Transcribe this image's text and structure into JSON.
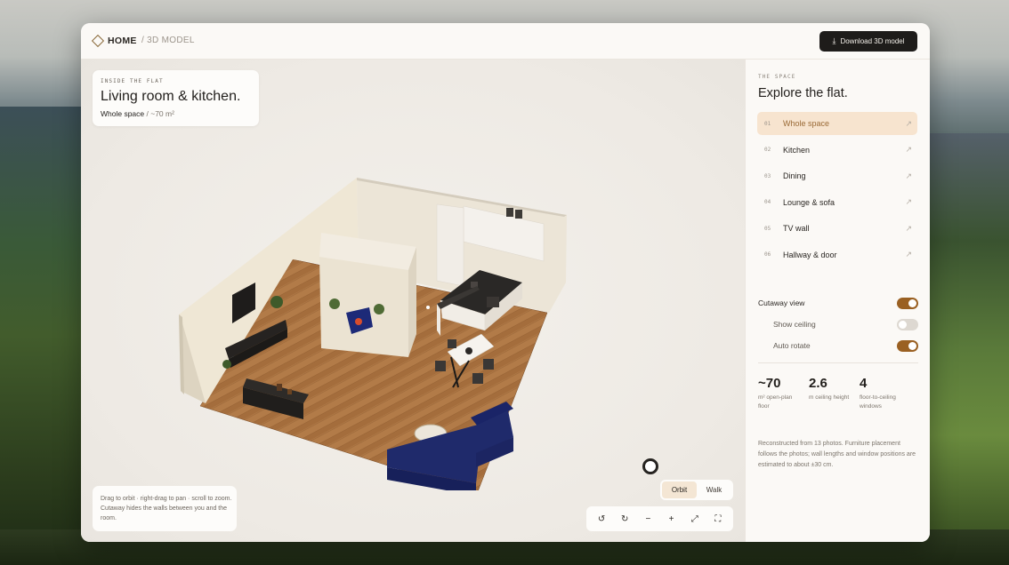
{
  "header": {
    "home_label": "HOME",
    "crumb_current": "/ 3D MODEL",
    "download_label": "Download 3D model"
  },
  "viewport": {
    "info": {
      "eyebrow": "INSIDE THE FLAT",
      "title": "Living room & kitchen.",
      "subtitle_primary": "Whole space",
      "subtitle_secondary": "/ ~70 m²"
    },
    "hint": "Drag to orbit · right-drag to pan · scroll to zoom. Cutaway hides the walls between you and the room.",
    "modes": [
      "Orbit",
      "Walk"
    ],
    "active_mode": "Orbit",
    "tools": [
      "rotate-left-icon",
      "rotate-right-icon",
      "zoom-out-icon",
      "zoom-in-icon",
      "expand-icon",
      "fullscreen-icon"
    ]
  },
  "sidebar": {
    "eyebrow": "THE SPACE",
    "title": "Explore the flat.",
    "items": [
      {
        "num": "01",
        "label": "Whole space",
        "active": true
      },
      {
        "num": "02",
        "label": "Kitchen",
        "active": false
      },
      {
        "num": "03",
        "label": "Dining",
        "active": false
      },
      {
        "num": "04",
        "label": "Lounge & sofa",
        "active": false
      },
      {
        "num": "05",
        "label": "TV wall",
        "active": false
      },
      {
        "num": "06",
        "label": "Hallway & door",
        "active": false
      }
    ],
    "toggles": [
      {
        "label": "Cutaway view",
        "on": true
      },
      {
        "label": "Show ceiling",
        "on": false
      },
      {
        "label": "Auto rotate",
        "on": true
      }
    ],
    "stats": [
      {
        "value": "~70",
        "label": "m² open-plan floor"
      },
      {
        "value": "2.6",
        "label": "m ceiling height"
      },
      {
        "value": "4",
        "label": "floor-to-ceiling windows"
      }
    ],
    "note": "Reconstructed from 13 photos. Furniture placement follows the photos; wall lengths and window positions are estimated to about ±30 cm."
  },
  "colors": {
    "accent": "#9a6022",
    "active_bg": "#f7e4cf",
    "sofa": "#1f2a6b",
    "floor": "#b07a48"
  }
}
